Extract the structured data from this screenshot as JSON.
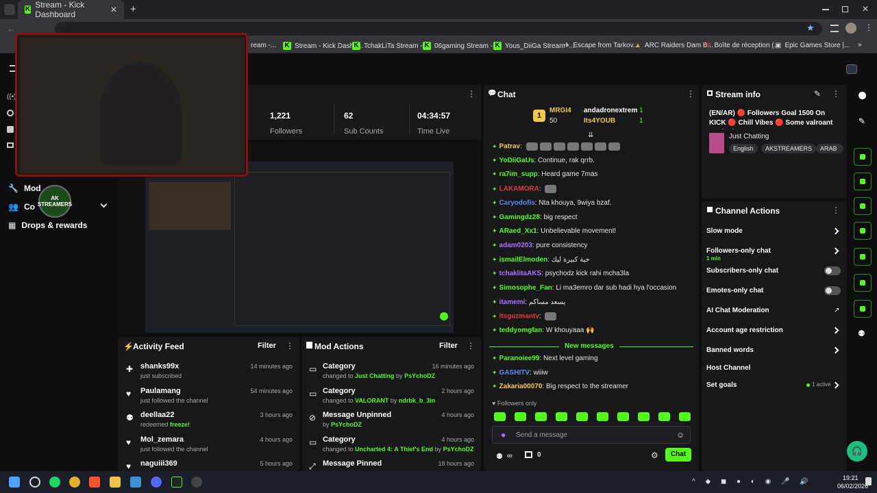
{
  "browser": {
    "tabs": [
      {
        "label": "Stream - Kick Dashboard",
        "active": true
      }
    ],
    "bookmarks": [
      "ream -...",
      "Stream - Kick Dashb...",
      "TchakLiTa Stream -...",
      "06gaming Stream -...",
      "Yous_DiiGa Stream -...",
      "Escape from Tarkov...",
      "ARC Raiders Dam B...",
      "Boîte de réception (...",
      "Epic Games Store |..."
    ]
  },
  "sidebar": {
    "items": [
      {
        "label": "Mod"
      },
      {
        "label": "Co"
      },
      {
        "label": "Drops & rewards"
      }
    ],
    "logo_text": "AK STREAMERS"
  },
  "stats": [
    {
      "value": "1,221",
      "label": "Followers"
    },
    {
      "value": "62",
      "label": "Sub Counts"
    },
    {
      "value": "04:34:57",
      "label": "Time Live"
    }
  ],
  "activity_feed": {
    "title": "Activity Feed",
    "filter_label": "Filter",
    "items": [
      {
        "user": "shanks99x",
        "action": "just subscribed",
        "time": "14 minutes ago"
      },
      {
        "user": "Paulamang",
        "action": "just followed the channel",
        "time": "54 minutes ago"
      },
      {
        "user": "deellaa22",
        "action": "redeemed ",
        "highlight": "freeze!",
        "time": "3 hours ago"
      },
      {
        "user": "Mol_zemara",
        "action": "just followed the channel",
        "time": "4 hours ago"
      },
      {
        "user": "naguiii369",
        "action": "",
        "time": "5 hours ago"
      }
    ]
  },
  "mod_actions": {
    "title": "Mod Actions",
    "filter_label": "Filter",
    "items": [
      {
        "title": "Category",
        "pre": "changed to ",
        "target": "Just Chatting",
        "by": " by ",
        "mod": "PsYchoDZ",
        "time": "16 minutes ago"
      },
      {
        "title": "Category",
        "pre": "changed to ",
        "target": "VALORANT",
        "by": " by ",
        "mod": "ndrbk_b_3in",
        "time": "2 hours ago"
      },
      {
        "title": "Message Unpinned",
        "pre": "",
        "target": "",
        "by": "by ",
        "mod": "PsYchoDZ",
        "time": "4 hours ago"
      },
      {
        "title": "Category",
        "pre": "changed to ",
        "target": "Uncharted 4: A Thief's End",
        "by": " by ",
        "mod": "PsYchoDZ",
        "time": "4 hours ago"
      },
      {
        "title": "Message Pinned",
        "pre": "",
        "target": "",
        "by": "",
        "mod": "",
        "time": "18 hours ago"
      }
    ]
  },
  "chat": {
    "title": "Chat",
    "leaderboard": {
      "rank": "1",
      "user1": "MRGI4",
      "score1": "50",
      "user2": "andadronextrem",
      "count2": "1",
      "user3": "Its4YOUB",
      "count3": "1"
    },
    "messages": [
      {
        "user": "Patrav",
        "color": "#f2c94c",
        "text": ""
      },
      {
        "user": "YoDiiGaUs",
        "color": "#53fc18",
        "text": "Continue, rak qrrb."
      },
      {
        "user": "ra7im_supp",
        "color": "#53fc18",
        "text": "Heard game 7mas"
      },
      {
        "user": "LAKAMORA",
        "color": "#e03c3c",
        "text": ""
      },
      {
        "user": "Caryodofis",
        "color": "#5b8def",
        "text": "Nta khouya, 9wiya bzaf."
      },
      {
        "user": "Gamingdz28",
        "color": "#53fc18",
        "text": "big respect"
      },
      {
        "user": "ARaed_Xx1",
        "color": "#53fc18",
        "text": "Unbelievable movement!"
      },
      {
        "user": "adam0203",
        "color": "#a970ff",
        "text": "pure consistency"
      },
      {
        "user": "ismailElmoden",
        "color": "#53fc18",
        "text": "حية كبيرة ليك"
      },
      {
        "user": "tchaklitaAKS",
        "color": "#a970ff",
        "text": "psychodz kick rahi mcha3la"
      },
      {
        "user": "Simosophe_Fan",
        "color": "#53fc18",
        "text": "Li ma3emro dar sub hadi hya l'occasion"
      },
      {
        "user": "itamemi",
        "color": "#a970ff",
        "text": "يسعد مساكم"
      },
      {
        "user": "itsguzmantv",
        "color": "#e03c3c",
        "text": ""
      },
      {
        "user": "teddyomgfan",
        "color": "#53fc18",
        "text": "W khouyaaa 🙌"
      }
    ],
    "new_messages_label": "New messages",
    "new_messages": [
      {
        "user": "Paranoiee99",
        "color": "#53fc18",
        "text": "Next level gaming"
      },
      {
        "user": "GASHITV",
        "color": "#5b8def",
        "text": "wiiiw"
      },
      {
        "user": "Zakaria00070",
        "color": "#f2c94c",
        "text": "Big respect to the streamer"
      }
    ],
    "followers_only_label": "Followers only",
    "input_placeholder": "Send a message",
    "points": "0",
    "send_label": "Chat"
  },
  "stream_info": {
    "title": "Stream info",
    "stream_title": "(EN/AR) 🔴 Followers Goal 1500 On KICK 🔴 Chill Vibes 🔴 Some valroant Ranked...",
    "category": "Just Chatting",
    "tags": [
      "English",
      "AKSTREAMERS",
      "ARAB"
    ]
  },
  "channel_actions": {
    "title": "Channel Actions",
    "items": [
      {
        "label": "Slow mode",
        "sub": "",
        "control": "chevron"
      },
      {
        "label": "Followers-only chat",
        "sub": "1 min",
        "control": "chevron"
      },
      {
        "label": "Subscribers-only chat",
        "sub": "",
        "control": "toggle"
      },
      {
        "label": "Emotes-only chat",
        "sub": "",
        "control": "toggle"
      },
      {
        "label": "AI Chat Moderation",
        "sub": "",
        "control": "link"
      },
      {
        "label": "Account age restriction",
        "sub": "",
        "control": "chevron"
      },
      {
        "label": "Banned words",
        "sub": "",
        "control": "chevron"
      },
      {
        "label": "Host Channel",
        "sub": "",
        "control": "none"
      },
      {
        "label": "Set goals",
        "sub": "1 active",
        "control": "chevron"
      }
    ]
  },
  "taskbar": {
    "time": "19:21",
    "date": "06/02/2026"
  },
  "colors": {
    "accent": "#53fc18",
    "panel": "#18181b",
    "background": "#0e0e10"
  }
}
